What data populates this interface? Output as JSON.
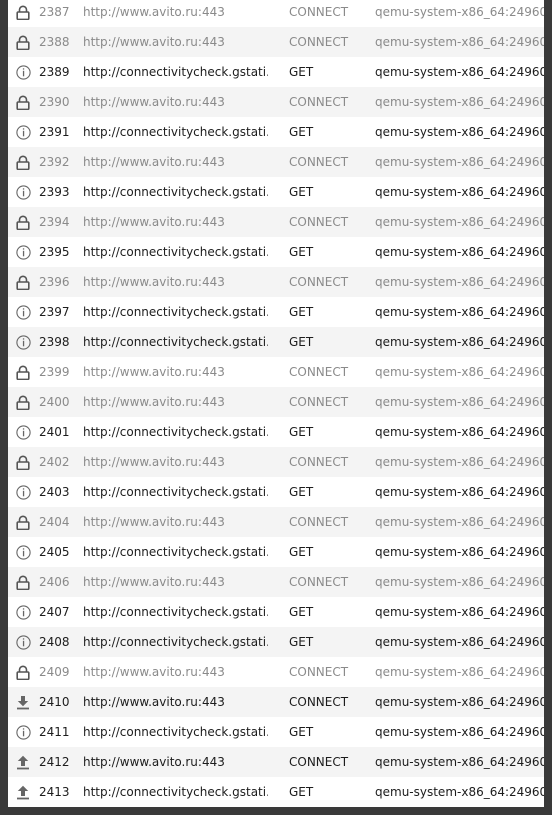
{
  "sessions": [
    {
      "id": "2387",
      "url": "http://www.avito.ru:443",
      "method": "CONNECT",
      "client": "qemu-system-x86_64:24960",
      "icon": "lock-icon",
      "dim": true
    },
    {
      "id": "2388",
      "url": "http://www.avito.ru:443",
      "method": "CONNECT",
      "client": "qemu-system-x86_64:24960",
      "icon": "lock-icon",
      "dim": true
    },
    {
      "id": "2389",
      "url": "http://connectivitycheck.gstati...",
      "method": "GET",
      "client": "qemu-system-x86_64:24960",
      "icon": "info-icon",
      "dim": false
    },
    {
      "id": "2390",
      "url": "http://www.avito.ru:443",
      "method": "CONNECT",
      "client": "qemu-system-x86_64:24960",
      "icon": "lock-icon",
      "dim": true
    },
    {
      "id": "2391",
      "url": "http://connectivitycheck.gstati...",
      "method": "GET",
      "client": "qemu-system-x86_64:24960",
      "icon": "info-icon",
      "dim": false
    },
    {
      "id": "2392",
      "url": "http://www.avito.ru:443",
      "method": "CONNECT",
      "client": "qemu-system-x86_64:24960",
      "icon": "lock-icon",
      "dim": true
    },
    {
      "id": "2393",
      "url": "http://connectivitycheck.gstati...",
      "method": "GET",
      "client": "qemu-system-x86_64:24960",
      "icon": "info-icon",
      "dim": false
    },
    {
      "id": "2394",
      "url": "http://www.avito.ru:443",
      "method": "CONNECT",
      "client": "qemu-system-x86_64:24960",
      "icon": "lock-icon",
      "dim": true
    },
    {
      "id": "2395",
      "url": "http://connectivitycheck.gstati...",
      "method": "GET",
      "client": "qemu-system-x86_64:24960",
      "icon": "info-icon",
      "dim": false
    },
    {
      "id": "2396",
      "url": "http://www.avito.ru:443",
      "method": "CONNECT",
      "client": "qemu-system-x86_64:24960",
      "icon": "lock-icon",
      "dim": true
    },
    {
      "id": "2397",
      "url": "http://connectivitycheck.gstati...",
      "method": "GET",
      "client": "qemu-system-x86_64:24960",
      "icon": "info-icon",
      "dim": false
    },
    {
      "id": "2398",
      "url": "http://connectivitycheck.gstati...",
      "method": "GET",
      "client": "qemu-system-x86_64:24960",
      "icon": "info-icon",
      "dim": false
    },
    {
      "id": "2399",
      "url": "http://www.avito.ru:443",
      "method": "CONNECT",
      "client": "qemu-system-x86_64:24960",
      "icon": "lock-icon",
      "dim": true
    },
    {
      "id": "2400",
      "url": "http://www.avito.ru:443",
      "method": "CONNECT",
      "client": "qemu-system-x86_64:24960",
      "icon": "lock-icon",
      "dim": true
    },
    {
      "id": "2401",
      "url": "http://connectivitycheck.gstati...",
      "method": "GET",
      "client": "qemu-system-x86_64:24960",
      "icon": "info-icon",
      "dim": false
    },
    {
      "id": "2402",
      "url": "http://www.avito.ru:443",
      "method": "CONNECT",
      "client": "qemu-system-x86_64:24960",
      "icon": "lock-icon",
      "dim": true
    },
    {
      "id": "2403",
      "url": "http://connectivitycheck.gstati...",
      "method": "GET",
      "client": "qemu-system-x86_64:24960",
      "icon": "info-icon",
      "dim": false
    },
    {
      "id": "2404",
      "url": "http://www.avito.ru:443",
      "method": "CONNECT",
      "client": "qemu-system-x86_64:24960",
      "icon": "lock-icon",
      "dim": true
    },
    {
      "id": "2405",
      "url": "http://connectivitycheck.gstati...",
      "method": "GET",
      "client": "qemu-system-x86_64:24960",
      "icon": "info-icon",
      "dim": false
    },
    {
      "id": "2406",
      "url": "http://www.avito.ru:443",
      "method": "CONNECT",
      "client": "qemu-system-x86_64:24960",
      "icon": "lock-icon",
      "dim": true
    },
    {
      "id": "2407",
      "url": "http://connectivitycheck.gstati...",
      "method": "GET",
      "client": "qemu-system-x86_64:24960",
      "icon": "info-icon",
      "dim": false
    },
    {
      "id": "2408",
      "url": "http://connectivitycheck.gstati...",
      "method": "GET",
      "client": "qemu-system-x86_64:24960",
      "icon": "info-icon",
      "dim": false
    },
    {
      "id": "2409",
      "url": "http://www.avito.ru:443",
      "method": "CONNECT",
      "client": "qemu-system-x86_64:24960",
      "icon": "lock-icon",
      "dim": true
    },
    {
      "id": "2410",
      "url": "http://www.avito.ru:443",
      "method": "CONNECT",
      "client": "qemu-system-x86_64:24960",
      "icon": "download-icon",
      "dim": false
    },
    {
      "id": "2411",
      "url": "http://connectivitycheck.gstati...",
      "method": "GET",
      "client": "qemu-system-x86_64:24960",
      "icon": "info-icon",
      "dim": false
    },
    {
      "id": "2412",
      "url": "http://www.avito.ru:443",
      "method": "CONNECT",
      "client": "qemu-system-x86_64:24960",
      "icon": "upload-icon",
      "dim": false
    },
    {
      "id": "2413",
      "url": "http://connectivitycheck.gstati...",
      "method": "GET",
      "client": "qemu-system-x86_64:24960",
      "icon": "upload-icon",
      "dim": false
    }
  ]
}
